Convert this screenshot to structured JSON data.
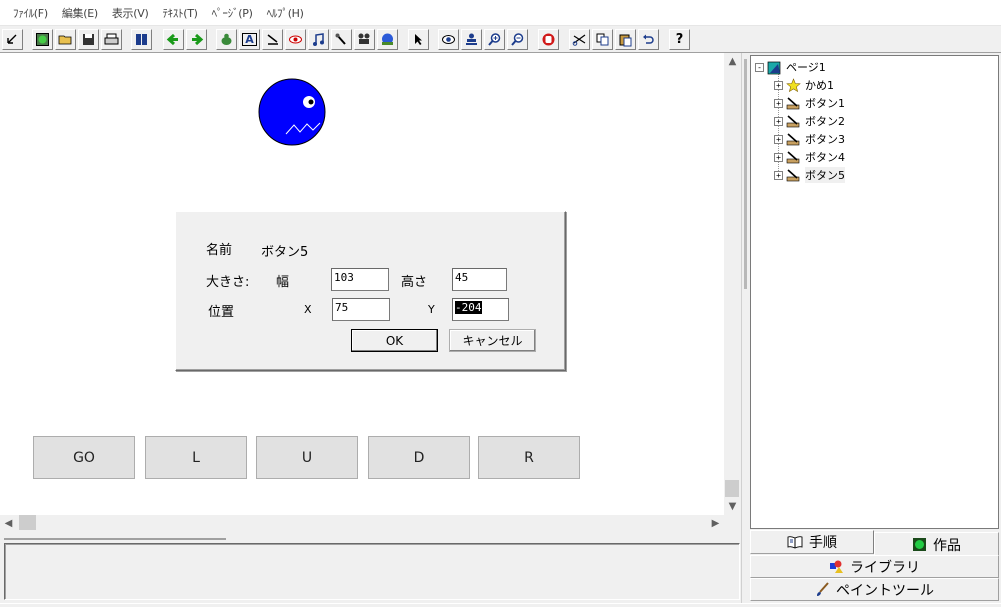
{
  "menubar": {
    "items": [
      {
        "label": "ﾌｧｲﾙ(F)"
      },
      {
        "label": "編集(E)"
      },
      {
        "label": "表示(V)"
      },
      {
        "label": "ﾃｷｽﾄ(T)"
      },
      {
        "label": "ﾍﾟｰｼﾞ(P)"
      },
      {
        "label": "ﾍﾙﾌﾟ(H)"
      }
    ]
  },
  "toolbar": {
    "help_label": "?",
    "text_tool_label": "A"
  },
  "stage": {
    "character": {
      "name": "かめ1",
      "color": "#0000ff"
    },
    "buttons": [
      {
        "label": "GO"
      },
      {
        "label": "L"
      },
      {
        "label": "U"
      },
      {
        "label": "D"
      },
      {
        "label": "R"
      }
    ]
  },
  "dialog": {
    "name_label": "名前",
    "name_value": "ボタン5",
    "size_label": "大きさ:",
    "width_label": "幅",
    "width_value": "103",
    "height_label": "高さ",
    "height_value": "45",
    "position_label": "位置",
    "x_label": "X",
    "x_value": "75",
    "y_label": "Y",
    "y_value": "-204",
    "ok_label": "OK",
    "cancel_label": "キャンセル"
  },
  "tree": {
    "root": {
      "label": "ページ1",
      "expander": "-"
    },
    "children": [
      {
        "label": "かめ1",
        "expander": "+",
        "icon": "turtle-icon"
      },
      {
        "label": "ボタン1",
        "expander": "+",
        "icon": "button-object-icon"
      },
      {
        "label": "ボタン2",
        "expander": "+",
        "icon": "button-object-icon"
      },
      {
        "label": "ボタン3",
        "expander": "+",
        "icon": "button-object-icon"
      },
      {
        "label": "ボタン4",
        "expander": "+",
        "icon": "button-object-icon"
      },
      {
        "label": "ボタン5",
        "expander": "+",
        "icon": "button-object-icon"
      }
    ]
  },
  "side_tabs": {
    "procedure": "手順",
    "works": "作品",
    "library": "ライブラリ",
    "paint_tool": "ペイントツール"
  },
  "colors": {
    "accent_blue": "#0000ff",
    "window_bg": "#f0f0f0"
  }
}
